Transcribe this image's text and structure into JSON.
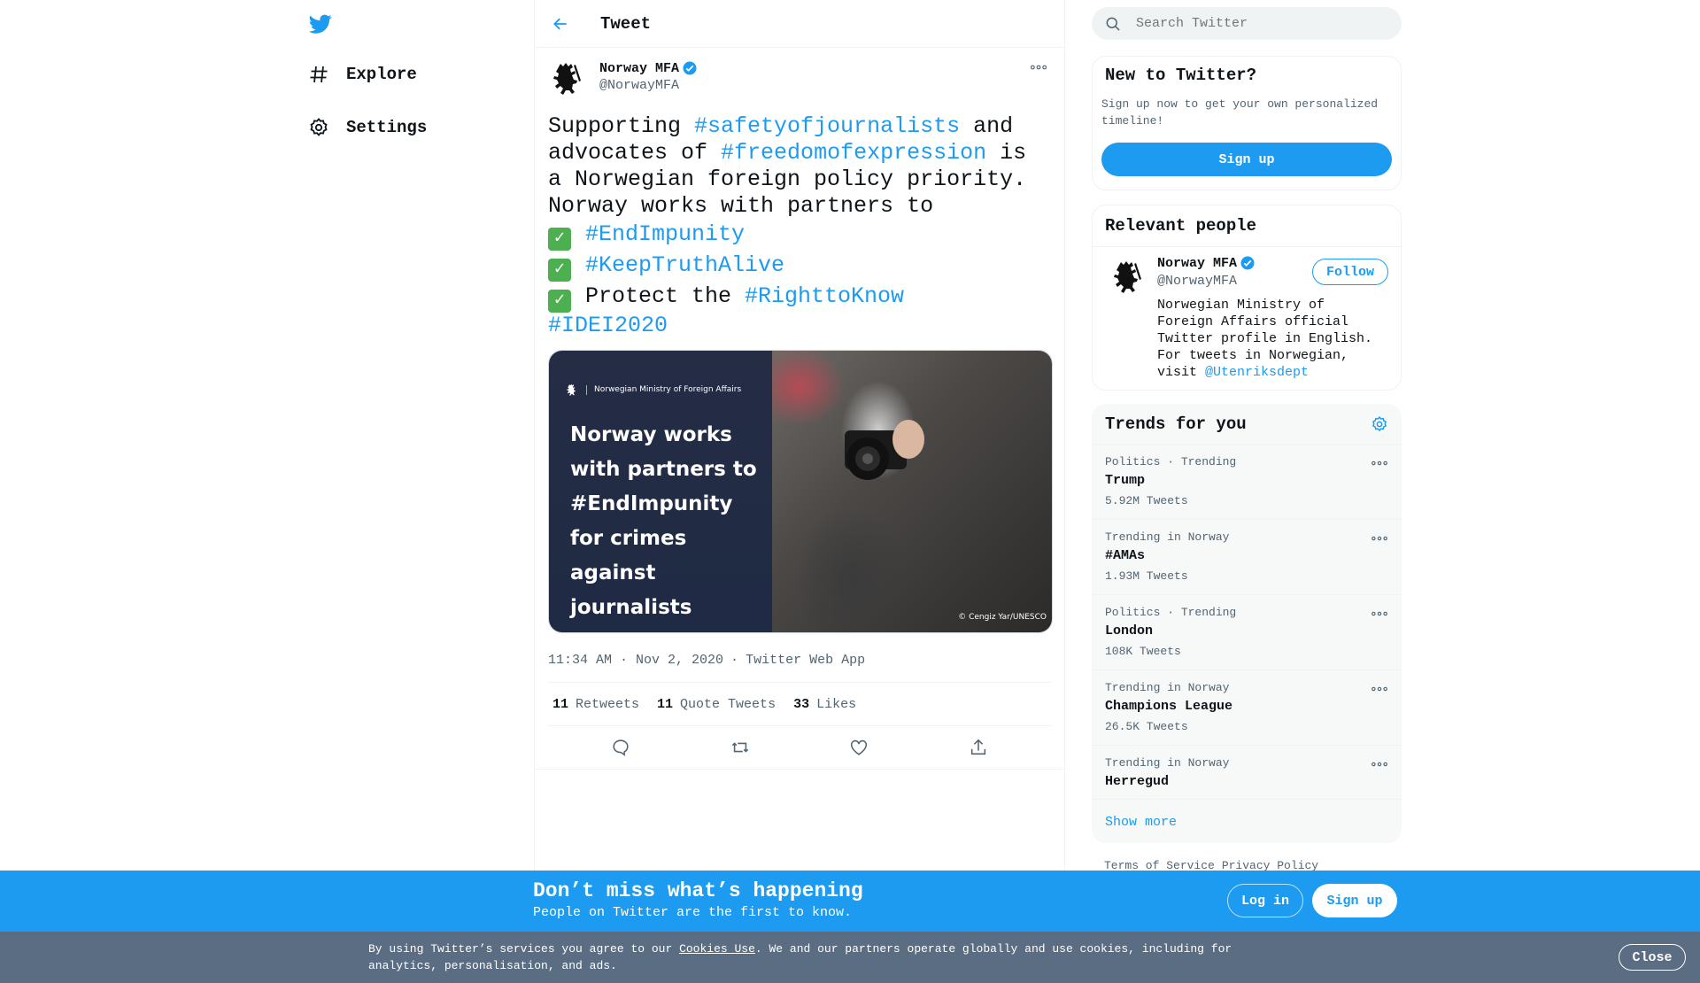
{
  "nav": {
    "logo_icon": "twitter-bird-icon",
    "items": [
      {
        "label": "Explore",
        "icon": "hashtag-icon"
      },
      {
        "label": "Settings",
        "icon": "gear-icon"
      }
    ]
  },
  "header": {
    "title": "Tweet",
    "back_icon": "arrow-left-icon"
  },
  "tweet": {
    "author_name": "Norway MFA",
    "author_handle": "@NorwayMFA",
    "text": {
      "p1": "Supporting ",
      "tag1": "#safetyofjournalists",
      "p2": " and advocates of ",
      "tag2": "#freedomofexpression",
      "p3": " is a Norwegian foreign policy priority. Norway works with partners to",
      "check": "✅",
      "tag3": "#EndImpunity",
      "tag4": "#KeepTruthAlive",
      "p4": "Protect the ",
      "tag5": "#RighttoKnow",
      "tag6": "#IDEI2020"
    },
    "media": {
      "ministry": "Norwegian Ministry of Foreign Affairs",
      "headline": "Norway works with partners to #EndImpunity for crimes against journalists",
      "credit": "© Cengiz Yar/UNESCO"
    },
    "time": "11:34 AM · Nov 2, 2020",
    "sep": "·",
    "source": "Twitter Web App",
    "stats": {
      "retweets_count": "11",
      "retweets_label": "Retweets",
      "quotes_count": "11",
      "quotes_label": "Quote Tweets",
      "likes_count": "33",
      "likes_label": "Likes"
    }
  },
  "search": {
    "placeholder": "Search Twitter"
  },
  "new_to_twitter": {
    "title": "New to Twitter?",
    "subtitle": "Sign up now to get your own personalized timeline!",
    "button": "Sign up"
  },
  "relevant": {
    "title": "Relevant people",
    "name": "Norway MFA",
    "handle": "@NorwayMFA",
    "follow": "Follow",
    "bio": "Norwegian Ministry of Foreign Affairs official Twitter profile in English. For tweets in Norwegian, visit ",
    "bio_link": "@Utenriksdept"
  },
  "trends": {
    "title": "Trends for you",
    "items": [
      {
        "context": "Politics · Trending",
        "name": "Trump",
        "count": "5.92M Tweets"
      },
      {
        "context": "Trending in Norway",
        "name": "#AMAs",
        "count": "1.93M Tweets"
      },
      {
        "context": "Politics · Trending",
        "name": "London",
        "count": "108K Tweets"
      },
      {
        "context": "Trending in Norway",
        "name": "Champions League",
        "count": "26.5K Tweets"
      },
      {
        "context": "Trending in Norway",
        "name": "Herregud",
        "count": ""
      }
    ],
    "show_more": "Show more"
  },
  "footer": {
    "terms": "Terms of Service",
    "privacy": "Privacy Policy"
  },
  "bottom_bar": {
    "title": "Don’t miss what’s happening",
    "subtitle": "People on Twitter are the first to know.",
    "login": "Log in",
    "signup": "Sign up"
  },
  "cookie": {
    "pre": "By using Twitter’s services you agree to our ",
    "link": "Cookies Use",
    "post": ". We and our partners operate globally and use cookies, including for analytics, personalisation, and ads.",
    "close": "Close"
  },
  "colors": {
    "accent": "#1d9bf0",
    "text": "#0f1419",
    "muted": "#536471",
    "cookie_bg": "#5a6d82"
  }
}
